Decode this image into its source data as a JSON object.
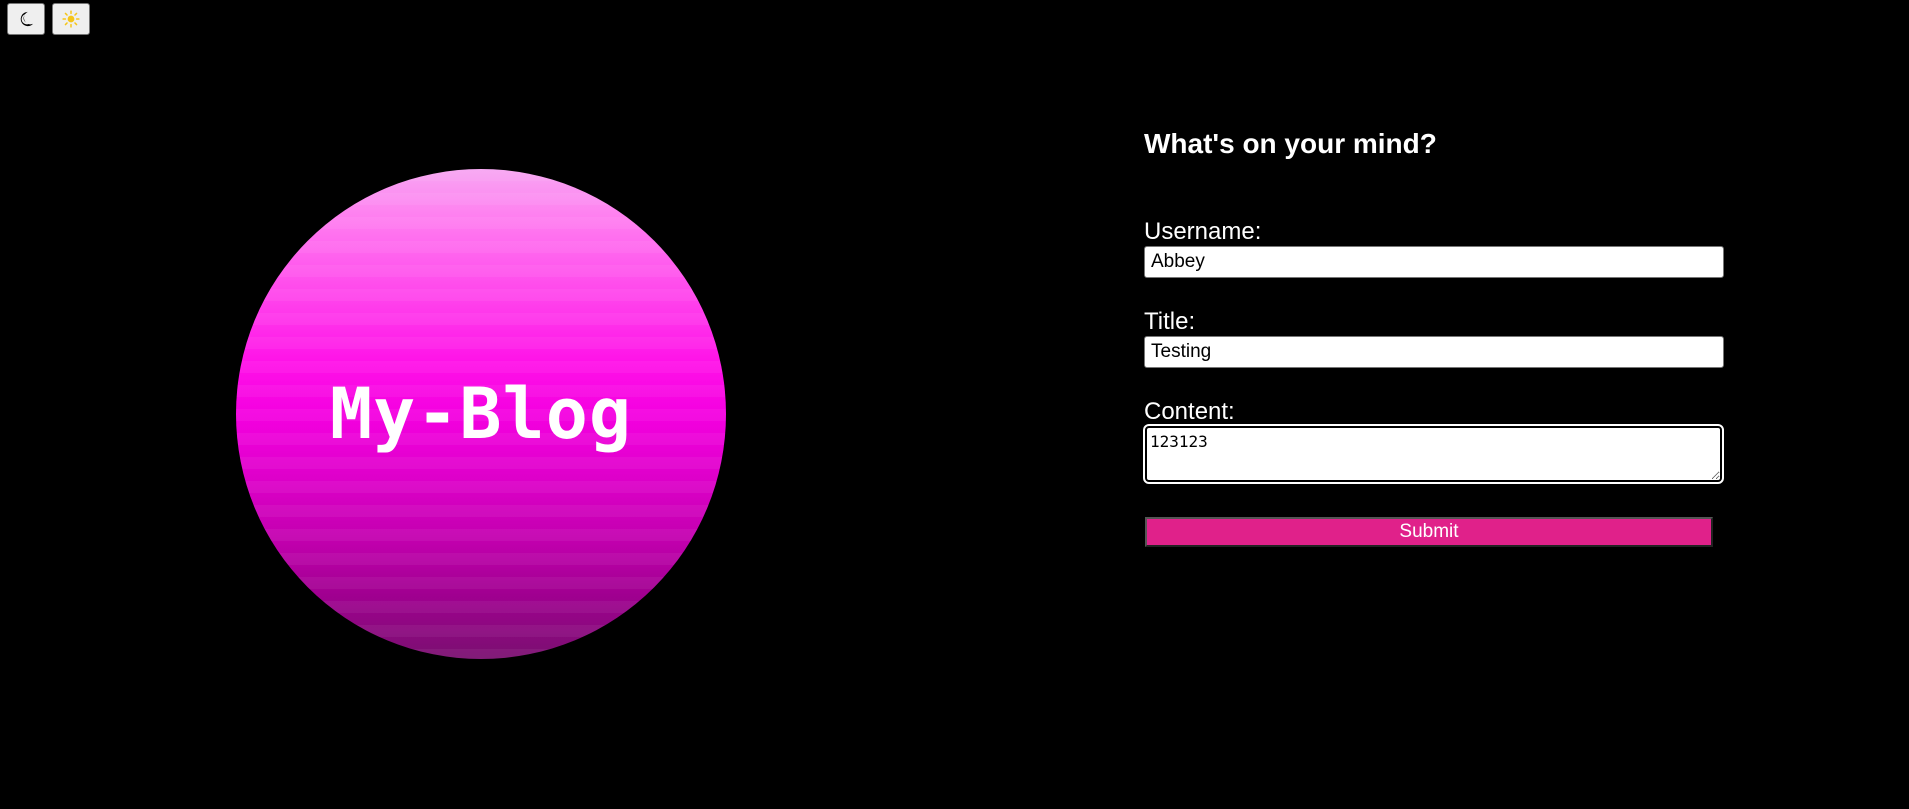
{
  "theme_toggles": {
    "dark_icon": "moon-icon",
    "light_icon": "sun-icon"
  },
  "logo": {
    "text": "My-Blog",
    "gradient_top": "#f7a6f2",
    "gradient_mid": "#ff10e8",
    "gradient_bottom": "#7a1070"
  },
  "form": {
    "heading": "What's on your mind?",
    "username_label": "Username:",
    "username_value": "Abbey",
    "title_label": "Title:",
    "title_value": "Testing",
    "content_label": "Content:",
    "content_value": "123123",
    "submit_label": "Submit",
    "submit_color": "#e0218a"
  }
}
